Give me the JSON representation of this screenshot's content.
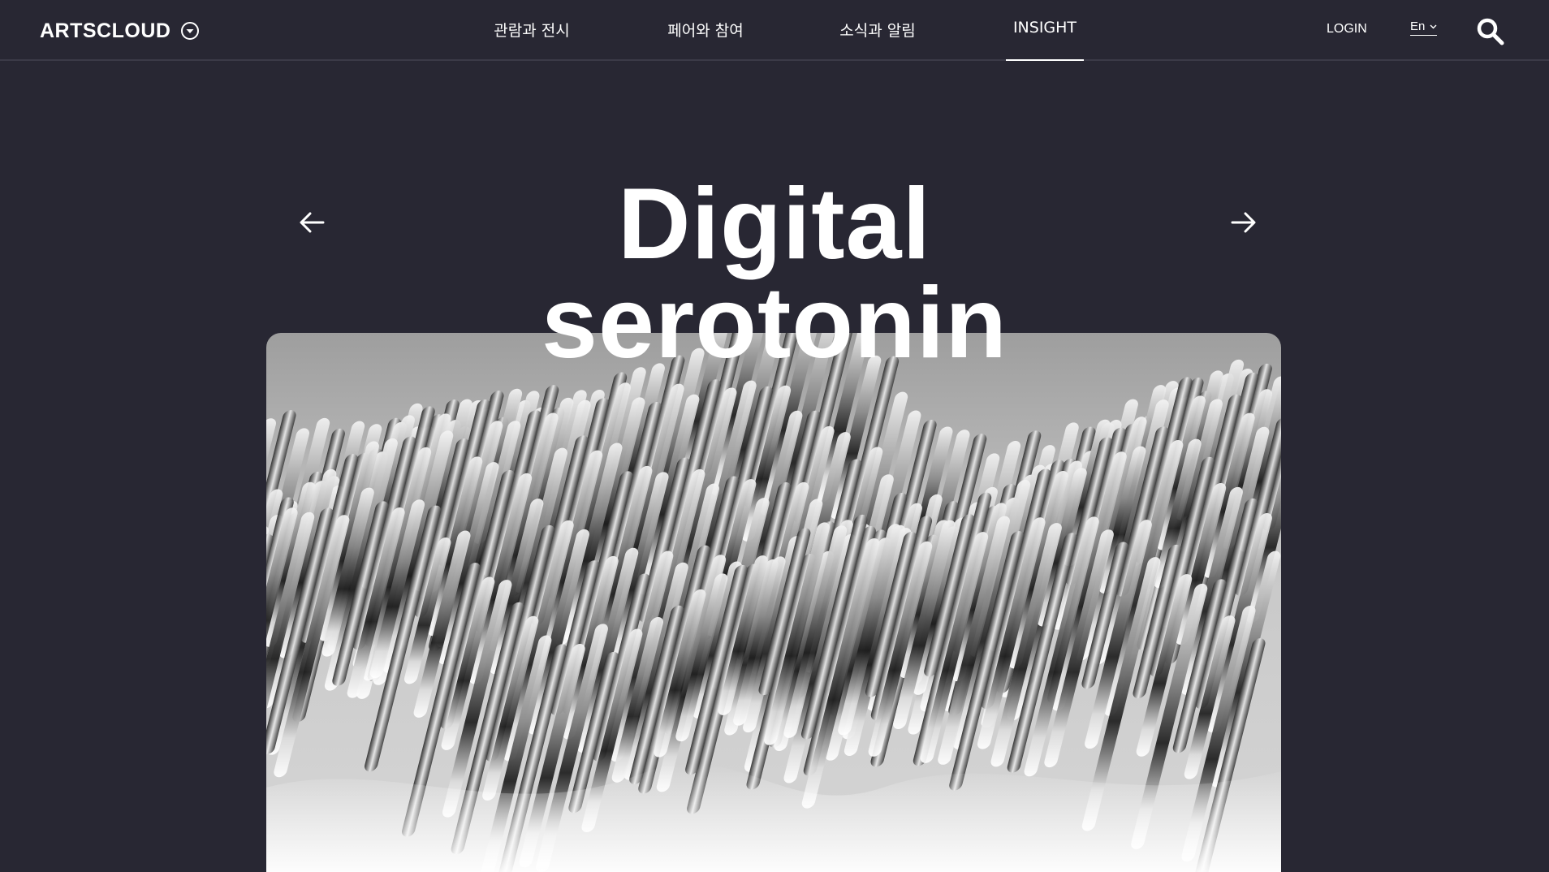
{
  "header": {
    "logo_text": "ARTSCLOUD",
    "logo_icon": "circle-chevron-down-icon",
    "nav": [
      {
        "label": "관람과 전시",
        "active": false
      },
      {
        "label": "페어와 참여",
        "active": false
      },
      {
        "label": "소식과 알림",
        "active": false
      },
      {
        "label": "INSIGHT",
        "active": true
      }
    ],
    "login_label": "LOGIN",
    "language": "En",
    "search_icon": "search-icon"
  },
  "hero": {
    "title_line1": "Digital",
    "title_line2": "serotonin",
    "prev_icon": "arrow-left-icon",
    "next_icon": "arrow-right-icon"
  },
  "colors": {
    "background": "#282733",
    "text": "#ffffff",
    "divider": "#3b3a47"
  }
}
